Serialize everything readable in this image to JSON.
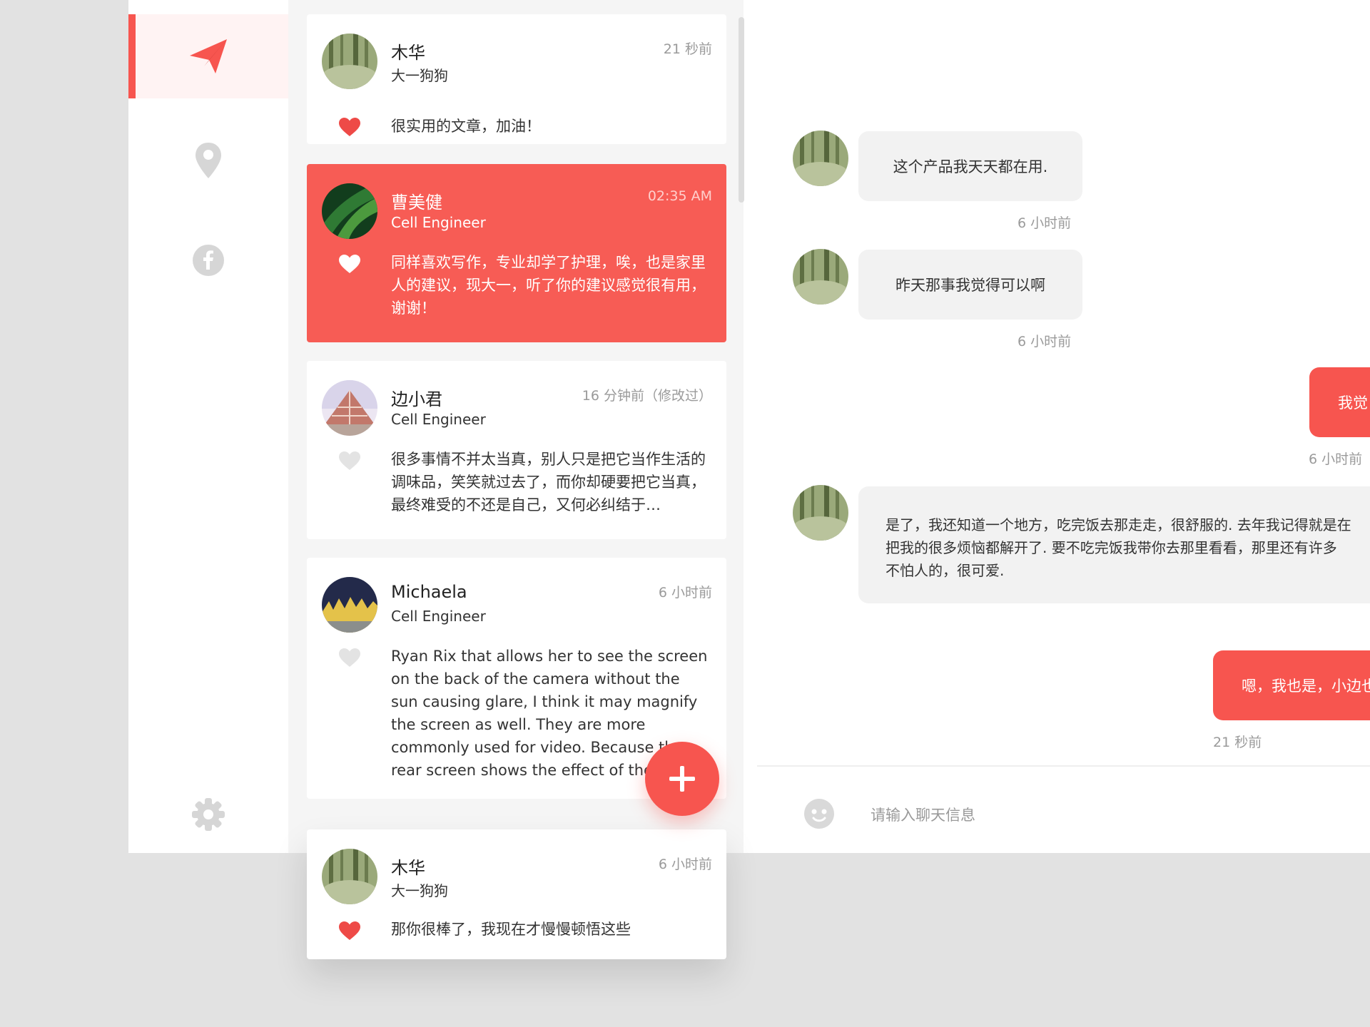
{
  "nav": {
    "items": [
      {
        "icon": "send-icon",
        "active": true
      },
      {
        "icon": "location-pin-icon",
        "active": false
      },
      {
        "icon": "facebook-icon",
        "active": false
      }
    ],
    "settings_icon": "gear-icon"
  },
  "conversations": [
    {
      "name": "木华",
      "subtitle": "大一狗狗",
      "time": "21 秒前",
      "message": "很实用的文章，加油！",
      "liked": true,
      "selected": false
    },
    {
      "name": "曹美健",
      "subtitle": "Cell Engineer",
      "time": "02:35 AM",
      "message": "同样喜欢写作，专业却学了护理，唉，也是家里人的建议，现大一，听了你的建议感觉很有用，谢谢！",
      "liked": true,
      "selected": true
    },
    {
      "name": "边小君",
      "subtitle": "Cell Engineer",
      "time": "16 分钟前（修改过）",
      "message": "很多事情不并太当真，别人只是把它当作生活的调味品，笑笑就过去了，而你却硬要把它当真，最终难受的不还是自己，又何必纠结于…",
      "liked": false,
      "selected": false
    },
    {
      "name": "Michaela",
      "subtitle": "Cell Engineer",
      "time": "6 小时前",
      "message": "Ryan Rix that allows her to see the screen on the back of the camera without the sun causing glare, I think it may magnify the screen as well.  They are more commonly used for video.  Because the rear screen shows the effect of the cameras.",
      "liked": false,
      "selected": false
    },
    {
      "name": "木华",
      "subtitle": "大一狗狗",
      "time": "6 小时前",
      "message": "那你很棒了，我现在才慢慢顿悟这些",
      "liked": true,
      "selected": false
    }
  ],
  "fab": {
    "icon": "plus-icon"
  },
  "chat": {
    "messages": [
      {
        "direction": "in",
        "text": "这个产品我天天都在用.",
        "time": "6 小时前"
      },
      {
        "direction": "in",
        "text": "昨天那事我觉得可以啊",
        "time": "6 小时前"
      },
      {
        "direction": "out",
        "text": "我觉",
        "time": "6 小时前"
      },
      {
        "direction": "in",
        "lines": [
          "是了，我还知道一个地方，吃完饭去那走走，很舒服的. 去年我记得就是在",
          "把我的很多烦恼都解开了. 要不吃完饭我带你去那里看看，那里还有许多",
          "不怕人的，很可爱."
        ],
        "time": ""
      },
      {
        "direction": "out",
        "text": "嗯，我也是，小边也",
        "time": "21 秒前"
      }
    ],
    "input_placeholder": "请输入聊天信息",
    "emoji_icon": "emoji-icon"
  },
  "colors": {
    "accent": "#f7554f",
    "background": "#e2e2e2",
    "panel": "#f5f5f5",
    "bubble": "#f2f2f2"
  }
}
